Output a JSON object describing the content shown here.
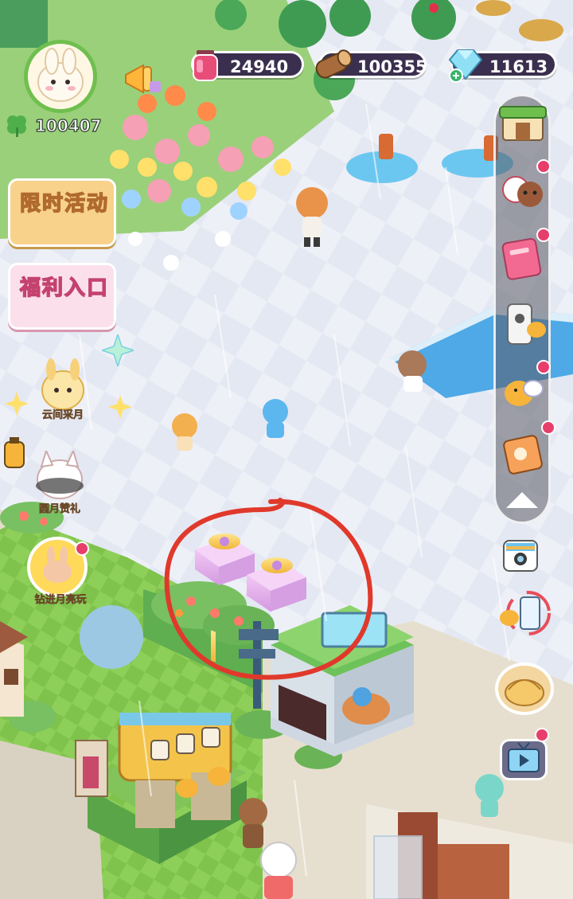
{
  "player": {
    "avatar": "bunny-avatar",
    "clover_count": "100407"
  },
  "resources": {
    "potion": {
      "icon": "potion-icon",
      "value": "24940",
      "color": "#e84d7a"
    },
    "wood": {
      "icon": "wood-log-icon",
      "value": "100355",
      "color": "#a86b3b"
    },
    "gem": {
      "icon": "gem-icon",
      "value": "11613",
      "color": "#7fd3ea"
    }
  },
  "left_menu": {
    "limited_event": "限时活动",
    "welfare_entry": "福利入口",
    "cloud_moon": "云间采月",
    "full_moon_gift": "圆月赞礼",
    "diamond_moon": "钻进月亮玩"
  },
  "right_menu": {
    "items": [
      "shop-icon",
      "animals-icon",
      "book-icon",
      "phone-icon",
      "chick-icon",
      "scroll-icon"
    ],
    "collapse": "chevron-up-icon"
  },
  "right_extra": {
    "camera": "camera-icon",
    "phone": "phone-swap-icon",
    "dumpling": "dumpling-icon",
    "tv": "tv-icon"
  },
  "scene": {
    "gifts": 2,
    "highlight_color": "#e0392b"
  }
}
